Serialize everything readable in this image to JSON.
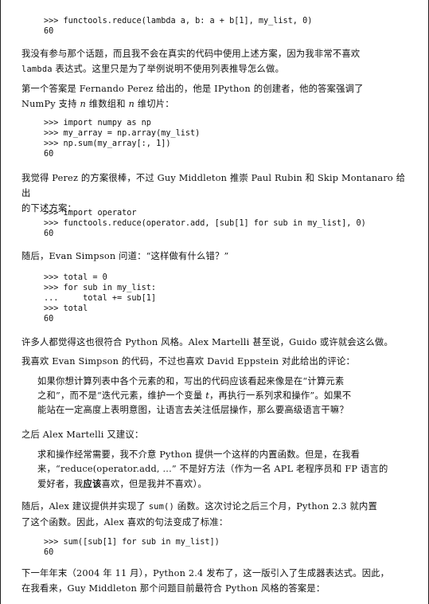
{
  "code1": [
    ">>> functools.reduce(lambda a, b: a + b[1], my_list, 0)",
    "60"
  ],
  "para1": {
    "a": "我没有参与那个话题，而且我不会在真实的代码中使用上述方案，因为我非常不喜欢",
    "b_mono": "lambda",
    "b": " 表达式。这里只是为了举例说明不使用列表推导怎么做。"
  },
  "para2": {
    "a": "第一个答案是 Fernando Perez 给出的，他是 IPython 的创建者，他的答案强调了",
    "b1": "NumPy 支持 ",
    "n1": "n",
    "b2": " 维数组和 ",
    "n2": "n",
    "b3": " 维切片："
  },
  "code2": [
    ">>> import numpy as np",
    ">>> my_array = np.array(my_list)",
    ">>> np.sum(my_array[:, 1])",
    "60"
  ],
  "para3": {
    "a": "我觉得 Perez 的方案很棒，不过 Guy Middleton 推崇 Paul Rubin 和 Skip Montanaro 给出",
    "b": "的下述方案："
  },
  "code3": [
    ">>> import operator",
    ">>> functools.reduce(operator.add, [sub[1] for sub in my_list], 0)",
    "60"
  ],
  "para4": "随后，Evan Simpson 问道：“这样做有什么错？”",
  "code4": [
    ">>> total = 0",
    ">>> for sub in my_list:",
    "...     total += sub[1]",
    ">>> total",
    "60"
  ],
  "para5": "许多人都觉得这也很符合 Python 风格。Alex Martelli 甚至说，Guido 或许就会这么做。",
  "para6": "我喜欢 Evan Simpson 的代码，不过也喜欢 David Eppstein 对此给出的评论：",
  "quote1": {
    "a1": "如果你想计算列表中各个元素的和，写出的代码应该看起来像是在“计算元素",
    "b1": "之和”，而不是“迭代元素，维护一个变量 ",
    "t": "t",
    "b2": "，再执行一系列求和操作”。如果不",
    "c": "能站在一定高度上表明意图，让语言去关注低层操作，那么要高级语言干嘛？"
  },
  "para7": "之后 Alex Martelli 又建议：",
  "quote2": {
    "a": "求和操作经常需要，我不介意 Python 提供一个这样的内置函数。但是，在我看",
    "b": "来，“reduce(operator.add, ...” 不是好方法（作为一名 APL 老程序员和 FP 语言的",
    "c1": "爱好者，我",
    "c_bold": "应该",
    "c2": "喜欢，但是我并不喜欢）。"
  },
  "para8": {
    "a1": "随后，Alex 建议提供并实现了 ",
    "a_mono": "sum()",
    "a2": " 函数。这次讨论之后三个月，Python 2.3 就内置",
    "b": "了这个函数。因此，Alex 喜欢的句法变成了标准："
  },
  "code5": [
    ">>> sum([sub[1] for sub in my_list])",
    "60"
  ],
  "para9": {
    "a": "下一年年末（2004 年 11 月），Python 2.4 发布了，这一版引入了生成器表达式。因此，",
    "b": "在我看来，Guy Middleton 那个问题目前最符合 Python 风格的答案是："
  }
}
